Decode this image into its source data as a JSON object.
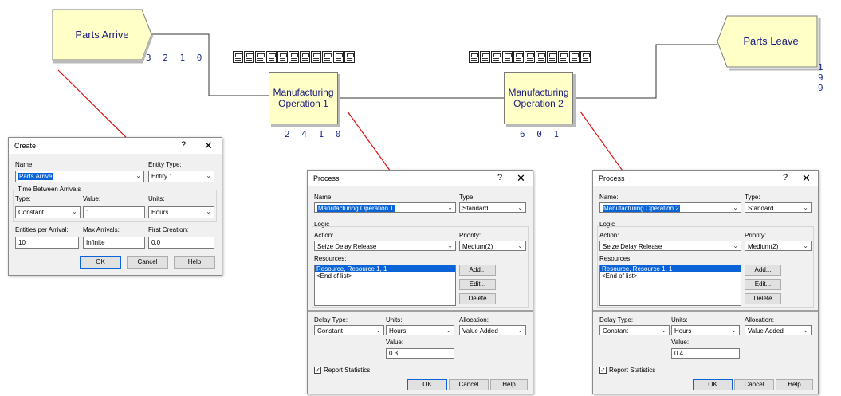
{
  "flowchart": {
    "parts_arrive": {
      "label": "Parts Arrive",
      "counter": "3 2 1 0"
    },
    "op1": {
      "label": "Manufacturing Operation 1",
      "counter": "2 4 1 0"
    },
    "op2": {
      "label": "Manufacturing Operation 2",
      "counter": "6 0 1"
    },
    "parts_leave": {
      "label": "Parts Leave",
      "counter": "1 9 9"
    }
  },
  "create_dialog": {
    "title": "Create",
    "help_q": "?",
    "close": "✕",
    "name_label": "Name:",
    "name_value": "Parts Arrive",
    "entity_type_label": "Entity Type:",
    "entity_type_value": "Entity 1",
    "tba_label": "Time Between Arrivals",
    "type_label": "Type:",
    "type_value": "Constant",
    "value_label": "Value:",
    "value_value": "1",
    "units_label": "Units:",
    "units_value": "Hours",
    "entities_label": "Entities per Arrival:",
    "entities_value": "10",
    "max_label": "Max Arrivals:",
    "max_value": "Infinite",
    "first_label": "First Creation:",
    "first_value": "0.0",
    "ok": "OK",
    "cancel": "Cancel",
    "help": "Help"
  },
  "process1": {
    "title": "Process",
    "help_q": "?",
    "close": "✕",
    "name_label": "Name:",
    "name_value": "Manufacturing Operation 1",
    "type_label": "Type:",
    "type_value": "Standard",
    "logic_label": "Logic",
    "action_label": "Action:",
    "action_value": "Seize Delay Release",
    "priority_label": "Priority:",
    "priority_value": "Medium(2)",
    "resources_label": "Resources:",
    "resources": [
      "Resource, Resource 1, 1",
      "<End of list>"
    ],
    "add": "Add...",
    "edit": "Edit...",
    "delete": "Delete",
    "delay_type_label": "Delay Type:",
    "delay_type_value": "Constant",
    "units_label": "Units:",
    "units_value": "Hours",
    "allocation_label": "Allocation:",
    "allocation_value": "Value Added",
    "value_label": "Value:",
    "value_value": "0.3",
    "report_label": "Report Statistics",
    "ok": "OK",
    "cancel": "Cancel",
    "help": "Help"
  },
  "process2": {
    "title": "Process",
    "help_q": "?",
    "close": "✕",
    "name_label": "Name:",
    "name_value": "Manufacturing Operation 2",
    "type_label": "Type:",
    "type_value": "Standard",
    "logic_label": "Logic",
    "action_label": "Action:",
    "action_value": "Seize Delay Release",
    "priority_label": "Priority:",
    "priority_value": "Medium(2)",
    "resources_label": "Resources:",
    "resources": [
      "Resource, Resource 1, 1",
      "<End of list>"
    ],
    "add": "Add...",
    "edit": "Edit...",
    "delete": "Delete",
    "delay_type_label": "Delay Type:",
    "delay_type_value": "Constant",
    "units_label": "Units:",
    "units_value": "Hours",
    "allocation_label": "Allocation:",
    "allocation_value": "Value Added",
    "value_label": "Value:",
    "value_value": "0.4",
    "report_label": "Report Statistics",
    "ok": "OK",
    "cancel": "Cancel",
    "help": "Help"
  },
  "colors": {
    "module_fill": "#ffffc8",
    "arrow": "#e01010",
    "counter": "#1a2a8a",
    "highlight": "#0a64d8"
  }
}
